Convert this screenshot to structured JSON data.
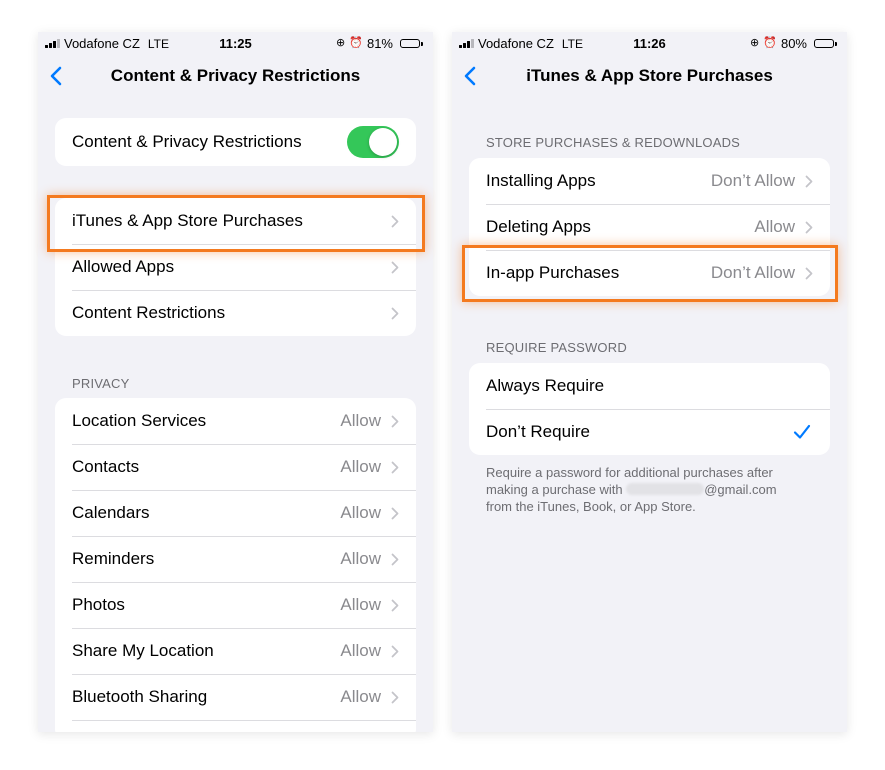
{
  "colors": {
    "accent": "#007aff",
    "toggle_on": "#34c759",
    "highlight": "#f47a1f",
    "secondary_text": "#8a8a8e",
    "background": "#f2f2f7"
  },
  "left": {
    "status": {
      "carrier": "Vodafone CZ",
      "network": "LTE",
      "time": "11:25",
      "battery": "81%",
      "battery_fraction": 0.81
    },
    "nav": {
      "back_icon": "chevron-left-icon",
      "title": "Content & Privacy Restrictions"
    },
    "master": {
      "label": "Content & Privacy Restrictions",
      "toggle_on": true
    },
    "store_group": [
      {
        "label": "iTunes & App Store Purchases",
        "highlighted": true
      },
      {
        "label": "Allowed Apps"
      },
      {
        "label": "Content Restrictions"
      }
    ],
    "privacy_header": "PRIVACY",
    "privacy_items": [
      {
        "label": "Location Services",
        "value": "Allow"
      },
      {
        "label": "Contacts",
        "value": "Allow"
      },
      {
        "label": "Calendars",
        "value": "Allow"
      },
      {
        "label": "Reminders",
        "value": "Allow"
      },
      {
        "label": "Photos",
        "value": "Allow"
      },
      {
        "label": "Share My Location",
        "value": "Allow"
      },
      {
        "label": "Bluetooth Sharing",
        "value": "Allow"
      }
    ]
  },
  "right": {
    "status": {
      "carrier": "Vodafone CZ",
      "network": "LTE",
      "time": "11:26",
      "battery": "80%",
      "battery_fraction": 0.8
    },
    "nav": {
      "back_icon": "chevron-left-icon",
      "title": "iTunes & App Store Purchases"
    },
    "store_header": "STORE PURCHASES & REDOWNLOADS",
    "store_items": [
      {
        "label": "Installing Apps",
        "value": "Don’t Allow"
      },
      {
        "label": "Deleting Apps",
        "value": "Allow"
      },
      {
        "label": "In-app Purchases",
        "value": "Don’t Allow",
        "highlighted": true
      }
    ],
    "password_header": "REQUIRE PASSWORD",
    "password_items": [
      {
        "label": "Always Require",
        "selected": false
      },
      {
        "label": "Don’t Require",
        "selected": true
      }
    ],
    "footer": {
      "line1": "Require a password for additional purchases after",
      "line2_pre": "making a purchase with ",
      "line2_post": "@gmail.com",
      "line3": "from the iTunes, Book, or App Store."
    }
  }
}
